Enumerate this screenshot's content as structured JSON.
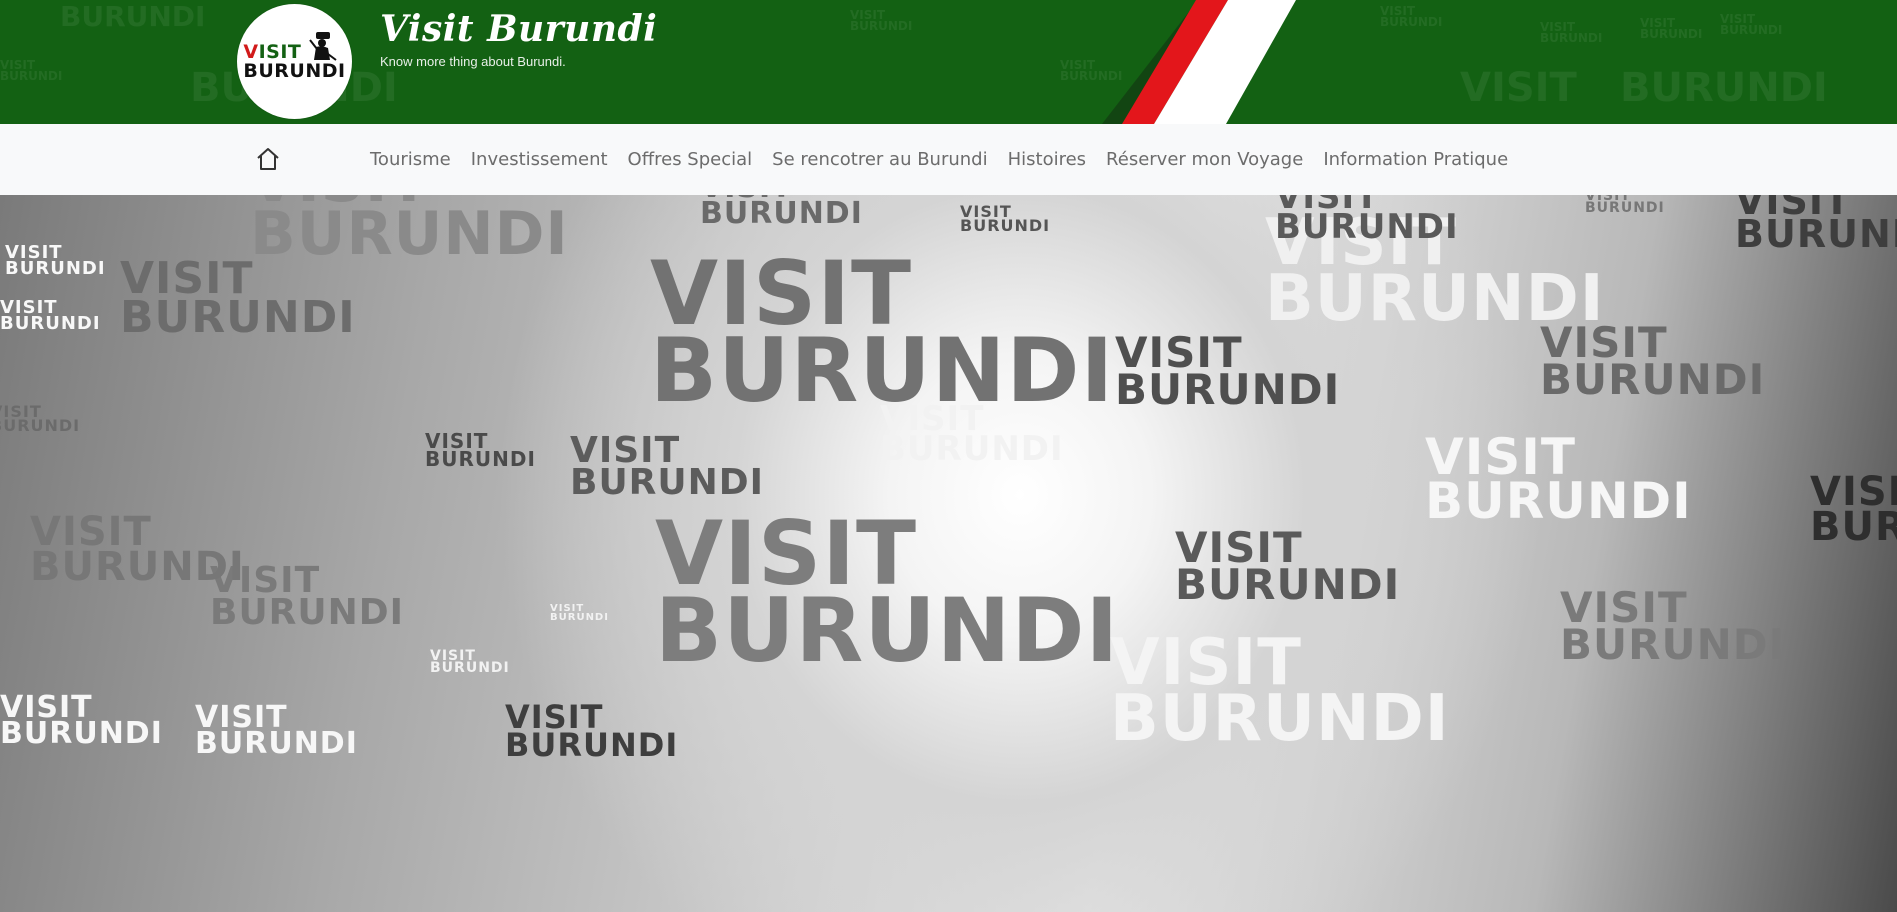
{
  "header": {
    "logo_line1": "VISIT",
    "logo_line2": "BURUNDI",
    "site_title": "Visit Burundi",
    "tagline": "Know more thing about Burundi."
  },
  "colors": {
    "header_bg": "#136113",
    "stripe_red": "#e3161b",
    "stripe_white": "#ffffff",
    "nav_bg": "#f8f9fa",
    "nav_text": "#6c6c6c"
  },
  "nav": {
    "home_icon": "home-icon",
    "items": [
      "Tourisme",
      "Investissement",
      "Offres Special",
      "Se rencotrer au Burundi",
      "Histoires",
      "Réserver mon Voyage",
      "Information Pratique"
    ]
  },
  "hero": {
    "watermark_line1": "VISIT",
    "watermark_line2": "BURUNDI"
  }
}
